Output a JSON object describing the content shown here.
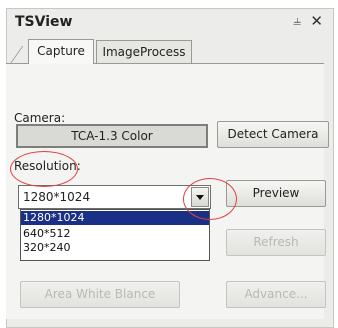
{
  "window": {
    "title": "TSView",
    "pin_glyph": "⫨",
    "close_glyph": "✕"
  },
  "tabs": [
    {
      "label": "Capture",
      "active": true
    },
    {
      "label": "ImageProcess",
      "active": false
    }
  ],
  "camera": {
    "label": "Camera:",
    "value": "TCA-1.3 Color",
    "detect_label": "Detect Camera"
  },
  "resolution": {
    "label": "Resolution:",
    "current_value": "1280*1024",
    "options": [
      "1280*1024",
      "640*512",
      "320*240"
    ],
    "selected_index": 0
  },
  "buttons": {
    "preview": "Preview",
    "refresh": "Refresh",
    "awb": "Area White Blance",
    "advance": "Advance..."
  },
  "colors": {
    "selection": "#1a2f86",
    "annotation_circle": "#e04040"
  }
}
